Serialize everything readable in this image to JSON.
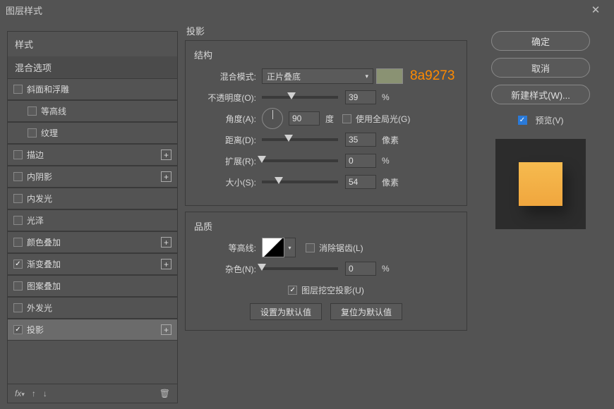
{
  "window": {
    "title": "图层样式"
  },
  "left": {
    "header": "样式",
    "subheader": "混合选项",
    "items": [
      {
        "label": "斜面和浮雕",
        "checked": false,
        "plus": false,
        "indent": false
      },
      {
        "label": "等高线",
        "checked": false,
        "plus": false,
        "indent": true
      },
      {
        "label": "纹理",
        "checked": false,
        "plus": false,
        "indent": true
      },
      {
        "label": "描边",
        "checked": false,
        "plus": true,
        "indent": false
      },
      {
        "label": "内阴影",
        "checked": false,
        "plus": true,
        "indent": false
      },
      {
        "label": "内发光",
        "checked": false,
        "plus": false,
        "indent": false
      },
      {
        "label": "光泽",
        "checked": false,
        "plus": false,
        "indent": false
      },
      {
        "label": "颜色叠加",
        "checked": false,
        "plus": true,
        "indent": false
      },
      {
        "label": "渐变叠加",
        "checked": true,
        "plus": true,
        "indent": false
      },
      {
        "label": "图案叠加",
        "checked": false,
        "plus": false,
        "indent": false
      },
      {
        "label": "外发光",
        "checked": false,
        "plus": false,
        "indent": false
      },
      {
        "label": "投影",
        "checked": true,
        "plus": true,
        "indent": false,
        "selected": true
      }
    ],
    "footer_fx": "fx"
  },
  "mid": {
    "title": "投影",
    "structure": {
      "heading": "结构",
      "blend_label": "混合模式:",
      "blend_value": "正片叠底",
      "color_hex": "8a9273",
      "color_swatch": "#8a9273",
      "opacity_label": "不透明度(O):",
      "opacity_value": "39",
      "opacity_unit": "%",
      "angle_label": "角度(A):",
      "angle_value": "90",
      "angle_unit": "度",
      "global_light_label": "使用全局光(G)",
      "distance_label": "距离(D):",
      "distance_value": "35",
      "distance_unit": "像素",
      "spread_label": "扩展(R):",
      "spread_value": "0",
      "spread_unit": "%",
      "size_label": "大小(S):",
      "size_value": "54",
      "size_unit": "像素"
    },
    "quality": {
      "heading": "品质",
      "contour_label": "等高线:",
      "antialias_label": "消除锯齿(L)",
      "noise_label": "杂色(N):",
      "noise_value": "0",
      "noise_unit": "%",
      "knockout_label": "图层挖空投影(U)",
      "reset_default": "设置为默认值",
      "restore_default": "复位为默认值"
    }
  },
  "right": {
    "ok": "确定",
    "cancel": "取消",
    "new_style": "新建样式(W)...",
    "preview": "预览(V)"
  }
}
